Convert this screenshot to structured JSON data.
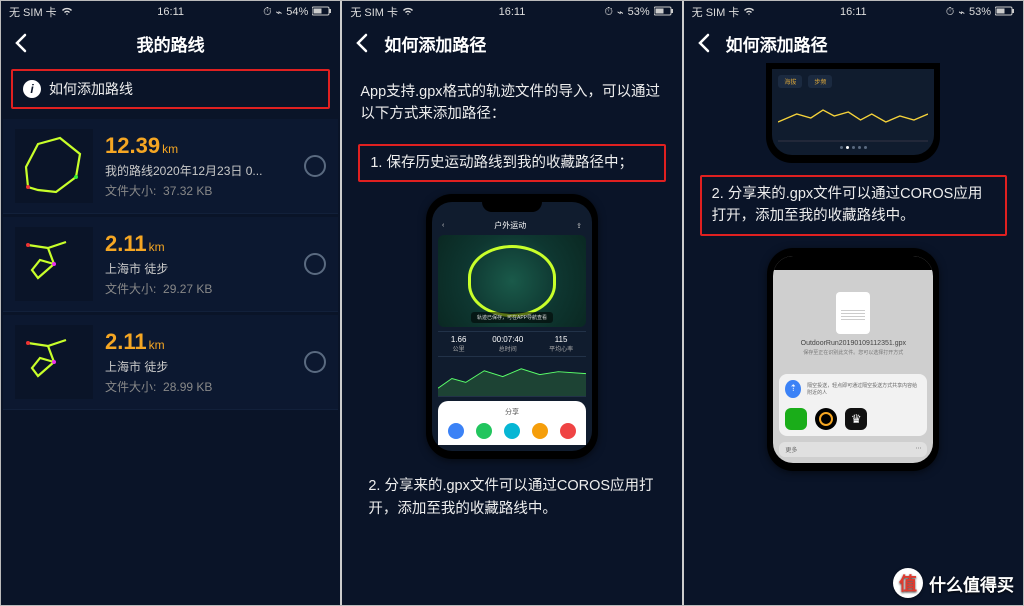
{
  "status": {
    "carrier": "无 SIM 卡",
    "time": "16:11",
    "battery_s1": "54%",
    "battery_s23": "53%",
    "bt_icon": "bluetooth-icon",
    "alarm_icon": "alarm-icon"
  },
  "screen1": {
    "header": "我的路线",
    "howto_label": "如何添加路线",
    "routes": [
      {
        "distance": "12.39",
        "unit": "km",
        "name": "我的路线2020年12月23日 0...",
        "size_label": "文件大小:",
        "size": "37.32 KB"
      },
      {
        "distance": "2.11",
        "unit": "km",
        "name": "上海市 徒步",
        "size_label": "文件大小:",
        "size": "29.27 KB"
      },
      {
        "distance": "2.11",
        "unit": "km",
        "name": "上海市 徒步",
        "size_label": "文件大小:",
        "size": "28.99 KB"
      }
    ]
  },
  "screen2": {
    "header": "如何添加路径",
    "intro": "App支持.gpx格式的轨迹文件的导入，可以通过以下方式来添加路径：",
    "step1": "1. 保存历史运动路线到我的收藏路径中；",
    "step2": "2. 分享来的.gpx文件可以通过COROS应用打开，添加至我的收藏路线中。",
    "mockup": {
      "mini_title": "户外运动",
      "tip": "轨迹已保存，可在APP导航查看",
      "stats": [
        {
          "v": "1.66",
          "l": "公里"
        },
        {
          "v": "00:07:40",
          "l": "总时间"
        },
        {
          "v": "115",
          "l": "平均心率"
        }
      ],
      "share_title": "分享"
    }
  },
  "screen3": {
    "header": "如何添加路径",
    "step2": "2. 分享来的.gpx文件可以通过COROS应用打开，添加至我的收藏路线中。",
    "chart_tabs": [
      "海拔",
      "步频"
    ],
    "file": {
      "name": "OutdoorRun20190109112351.gpx",
      "sub": "保存至正在识别此文件。您可以选择打开方式",
      "airdrop": "隔空投送，轻点即可通过隔空投送方式共享内容给附近的人",
      "more": "更多"
    }
  },
  "watermark": "什么值得买"
}
